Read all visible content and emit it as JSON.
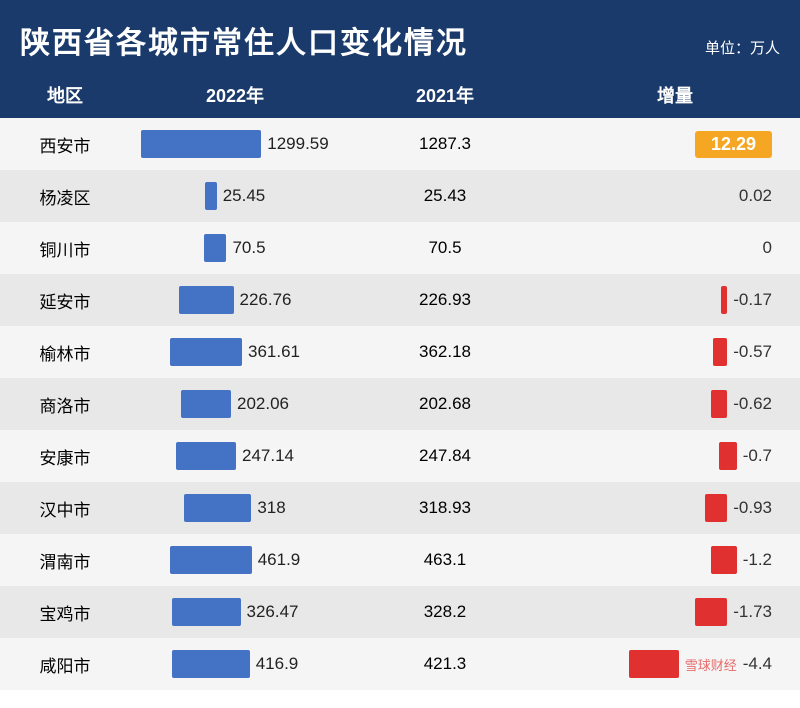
{
  "header": {
    "title": "陕西省各城市常住人口变化情况",
    "unit": "单位：万人"
  },
  "columns": {
    "region": "地区",
    "year2022": "2022年",
    "year2021": "2021年",
    "change": "增量"
  },
  "rows": [
    {
      "region": "西安市",
      "val2022": "1299.59",
      "val2021": "1287.3",
      "change": "12.29",
      "changeType": "positive",
      "bar2022": 120,
      "barChange": 50
    },
    {
      "region": "杨凌区",
      "val2022": "25.45",
      "val2021": "25.43",
      "change": "0.02",
      "changeType": "positive-small",
      "bar2022": 12,
      "barChange": 0
    },
    {
      "region": "铜川市",
      "val2022": "70.5",
      "val2021": "70.5",
      "change": "0",
      "changeType": "zero",
      "bar2022": 22,
      "barChange": 0
    },
    {
      "region": "延安市",
      "val2022": "226.76",
      "val2021": "226.93",
      "change": "-0.17",
      "changeType": "negative",
      "bar2022": 55,
      "barChange": 6
    },
    {
      "region": "榆林市",
      "val2022": "361.61",
      "val2021": "362.18",
      "change": "-0.57",
      "changeType": "negative",
      "bar2022": 72,
      "barChange": 14
    },
    {
      "region": "商洛市",
      "val2022": "202.06",
      "val2021": "202.68",
      "change": "-0.62",
      "changeType": "negative",
      "bar2022": 50,
      "barChange": 16
    },
    {
      "region": "安康市",
      "val2022": "247.14",
      "val2021": "247.84",
      "change": "-0.7",
      "changeType": "negative",
      "bar2022": 60,
      "barChange": 18
    },
    {
      "region": "汉中市",
      "val2022": "318",
      "val2021": "318.93",
      "change": "-0.93",
      "changeType": "negative",
      "bar2022": 67,
      "barChange": 22
    },
    {
      "region": "渭南市",
      "val2022": "461.9",
      "val2021": "463.1",
      "change": "-1.2",
      "changeType": "negative",
      "bar2022": 82,
      "barChange": 26
    },
    {
      "region": "宝鸡市",
      "val2022": "326.47",
      "val2021": "328.2",
      "change": "-1.73",
      "changeType": "negative",
      "bar2022": 69,
      "barChange": 32
    },
    {
      "region": "咸阳市",
      "val2022": "416.9",
      "val2021": "421.3",
      "change": "-4.4",
      "changeType": "negative",
      "bar2022": 78,
      "barChange": 50
    }
  ],
  "watermark": "雪球财经"
}
